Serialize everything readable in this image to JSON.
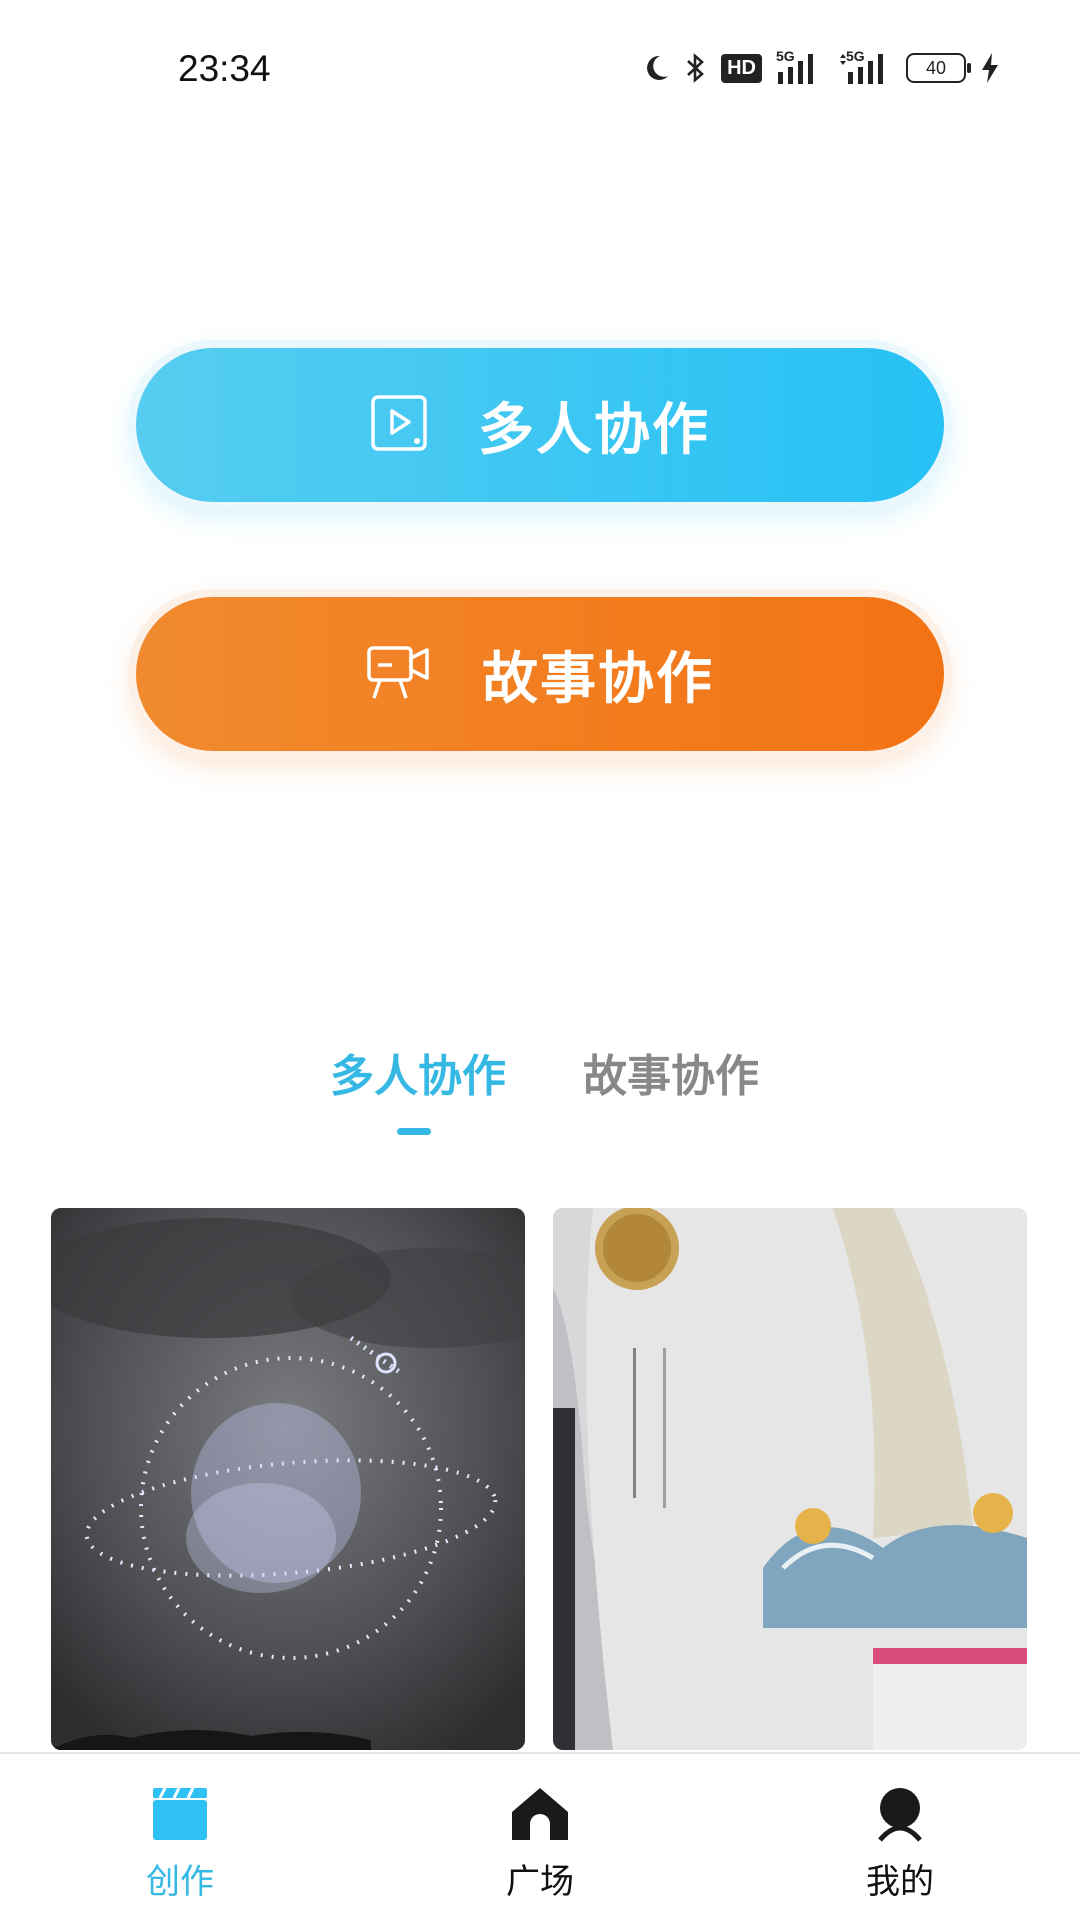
{
  "status_bar": {
    "time": "23:34",
    "hd_label": "HD",
    "signal_1_label": "5G",
    "signal_2_label": "5G",
    "battery_level": "40",
    "icons": [
      "moon-icon",
      "bluetooth-icon",
      "hd-icon",
      "signal-icon",
      "signal-icon",
      "battery-icon",
      "charging-icon"
    ]
  },
  "actions": {
    "multi_label": "多人协作",
    "story_label": "故事协作",
    "multi_color": "#26c1f5",
    "story_color": "#f37314"
  },
  "tabs": {
    "active": "多人协作",
    "inactive": "故事协作",
    "accent": "#35b8e4"
  },
  "cards": [
    {
      "icon": "drone-light-show-image"
    },
    {
      "icon": "seed-package-image"
    }
  ],
  "bottom_nav": {
    "items": [
      {
        "label": "创作",
        "icon": "clapperboard-icon",
        "active": true
      },
      {
        "label": "广场",
        "icon": "home-icon",
        "active": false
      },
      {
        "label": "我的",
        "icon": "user-icon",
        "active": false
      }
    ]
  }
}
